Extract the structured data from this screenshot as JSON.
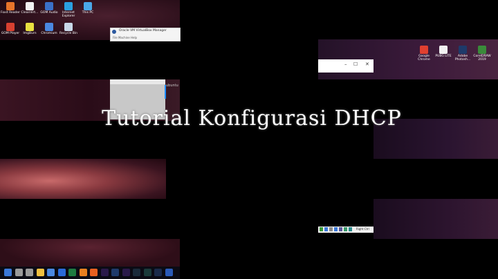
{
  "desktop_icons_left_row1": [
    {
      "label": "Foxit Reader",
      "icon": "foxit-icon",
      "color": "#e8742a"
    },
    {
      "label": "CleanVirt...",
      "icon": "cleaner-icon",
      "color": "#f2f2f2"
    },
    {
      "label": "GOM Audio",
      "icon": "gom-audio-icon",
      "color": "#3a70c8"
    },
    {
      "label": "Internet Explorer",
      "icon": "ie-icon",
      "color": "#2aa0e0"
    },
    {
      "label": "This PC",
      "icon": "this-pc-icon",
      "color": "#4aa8e8"
    }
  ],
  "desktop_icons_left_row2": [
    {
      "label": "GOM Player",
      "icon": "gom-player-icon",
      "color": "#d84030"
    },
    {
      "label": "ImgBurn",
      "icon": "imgburn-icon",
      "color": "#e8e040"
    },
    {
      "label": "Chromium",
      "icon": "chromium-icon",
      "color": "#4a88e0"
    },
    {
      "label": "Recycle Bin",
      "icon": "recycle-bin-icon",
      "color": "#c8d8e8"
    }
  ],
  "desktop_icons_right": [
    {
      "label": "Google Chrome",
      "icon": "chrome-icon",
      "color": "#e04030"
    },
    {
      "label": "PUBG LITE",
      "icon": "pubg-icon",
      "color": "#f2f2f2"
    },
    {
      "label": "Adobe Photosh...",
      "icon": "photoshop-icon",
      "color": "#1e3a6a"
    },
    {
      "label": "CorelDRAW 2019",
      "icon": "coreldraw-icon",
      "color": "#3a8a3a"
    }
  ],
  "virtualbox": {
    "title": "Oracle VM VirtualBox Manager",
    "menu": "File   Machine   Help"
  },
  "side_text": "ubuntu",
  "title": "Tutorial Konfigurasi DHCP",
  "window_controls": {
    "minimize": "–",
    "maximize": "☐",
    "close": "✕"
  },
  "tray": {
    "label": "Right Ctrl"
  },
  "taskbar_icons": [
    {
      "icon": "start-icon",
      "color": "#3a78d8"
    },
    {
      "icon": "search-icon",
      "color": "#9a9a9a"
    },
    {
      "icon": "task-view-icon",
      "color": "#9a9a9a"
    },
    {
      "icon": "file-explorer-icon",
      "color": "#f0c040"
    },
    {
      "icon": "store-icon",
      "color": "#4a88e0"
    },
    {
      "icon": "mail-icon",
      "color": "#2a6ad8"
    },
    {
      "icon": "excel-icon",
      "color": "#1e7a40"
    },
    {
      "icon": "vlc-icon",
      "color": "#e88020"
    },
    {
      "icon": "firefox-icon",
      "color": "#e86020"
    },
    {
      "icon": "premiere-icon",
      "color": "#2a1a4a"
    },
    {
      "icon": "photoshop-taskbar-icon",
      "color": "#1e3a6a"
    },
    {
      "icon": "after-effects-icon",
      "color": "#2a1a4a"
    },
    {
      "icon": "media-encoder-icon",
      "color": "#1a2a3a"
    },
    {
      "icon": "audition-icon",
      "color": "#1a3a3a"
    },
    {
      "icon": "lightroom-icon",
      "color": "#1a2a4a"
    },
    {
      "icon": "word-icon",
      "color": "#2a5ab8"
    }
  ]
}
